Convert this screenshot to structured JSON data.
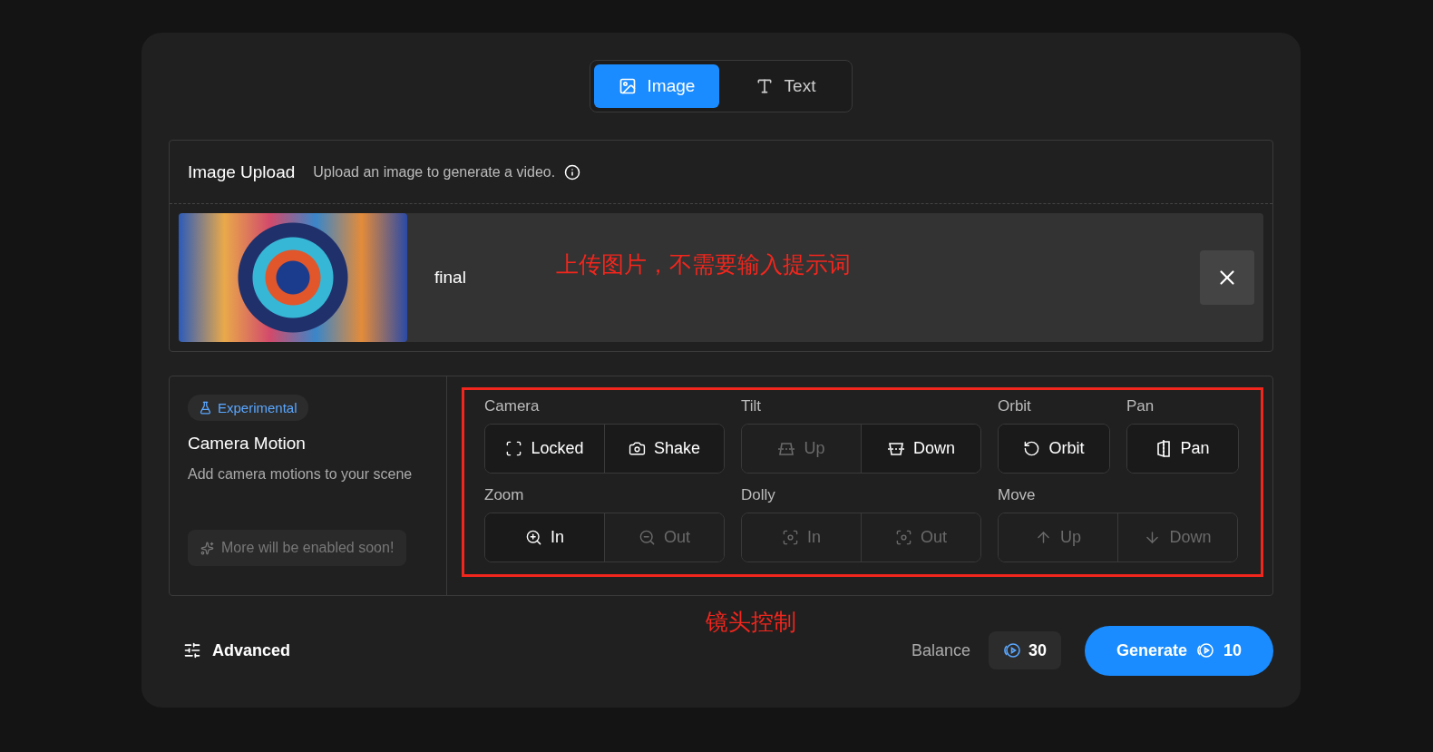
{
  "mode_tabs": [
    {
      "label": "Image",
      "kind": "image",
      "selected": true
    },
    {
      "label": "Text",
      "kind": "text",
      "selected": false
    }
  ],
  "upload": {
    "title": "Image Upload",
    "hint": "Upload an image to generate a video.",
    "file_name": "final",
    "annotation": "上传图片，不需要输入提示词"
  },
  "camera_motion": {
    "badge": "Experimental",
    "title": "Camera Motion",
    "description": "Add camera motions to your scene",
    "note": "More will be enabled soon!",
    "annotation": "镜头控制",
    "groups": [
      {
        "label": "Camera",
        "options": [
          {
            "label": "Locked",
            "kind": "corners",
            "disabled": false
          },
          {
            "label": "Shake",
            "kind": "camera",
            "disabled": false
          }
        ]
      },
      {
        "label": "Tilt",
        "options": [
          {
            "label": "Up",
            "kind": "tiltup",
            "disabled": true
          },
          {
            "label": "Down",
            "kind": "tiltdown",
            "disabled": false
          }
        ]
      },
      {
        "label": "Orbit",
        "options": [
          {
            "label": "Orbit",
            "kind": "orbit",
            "disabled": false
          }
        ]
      },
      {
        "label": "Pan",
        "options": [
          {
            "label": "Pan",
            "kind": "pan",
            "disabled": false
          }
        ]
      },
      {
        "label": "Zoom",
        "options": [
          {
            "label": "In",
            "kind": "zoomin",
            "disabled": false
          },
          {
            "label": "Out",
            "kind": "zoomout",
            "disabled": true
          }
        ]
      },
      {
        "label": "Dolly",
        "options": [
          {
            "label": "In",
            "kind": "focus",
            "disabled": true
          },
          {
            "label": "Out",
            "kind": "focus",
            "disabled": true
          }
        ]
      },
      {
        "label": "Move",
        "options": [
          {
            "label": "Up",
            "kind": "up",
            "disabled": true
          },
          {
            "label": "Down",
            "kind": "down",
            "disabled": true
          }
        ]
      }
    ]
  },
  "footer": {
    "advanced": "Advanced",
    "balance_label": "Balance",
    "balance": "30",
    "generate": "Generate",
    "cost": "10"
  }
}
